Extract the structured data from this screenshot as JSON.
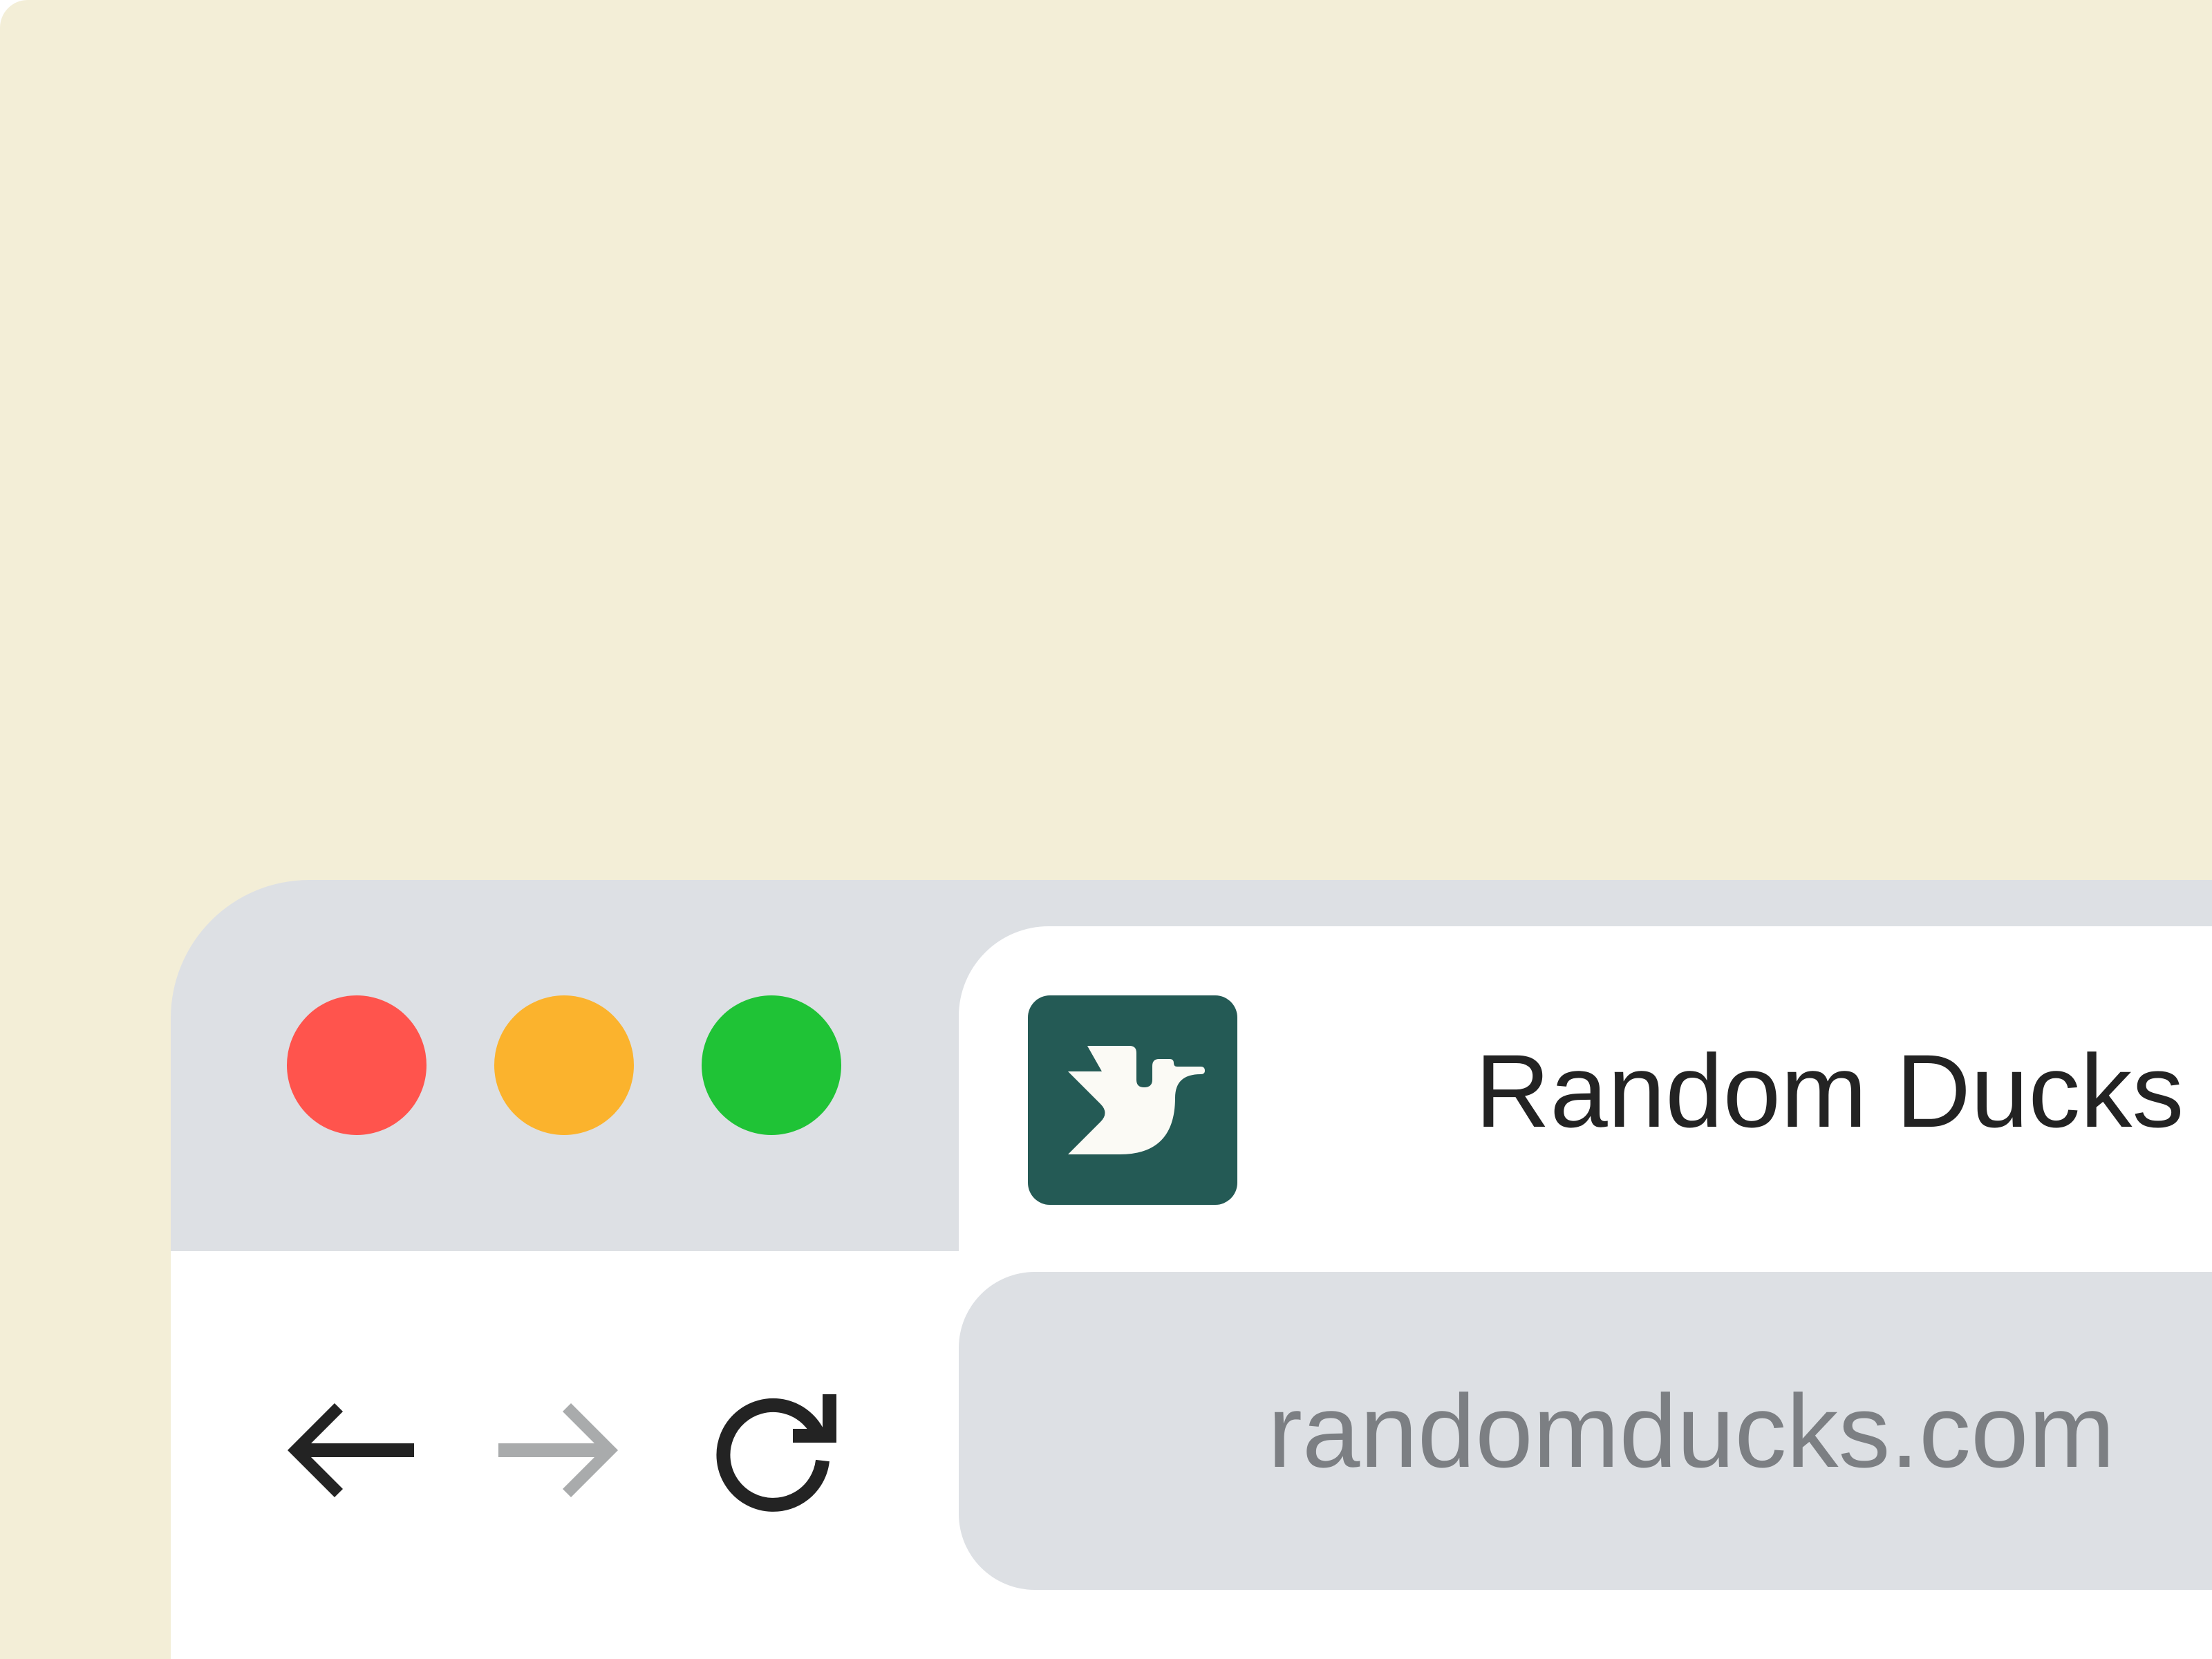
{
  "window": {
    "traffic_lights": [
      {
        "name": "close",
        "color": "#ff544d"
      },
      {
        "name": "minimize",
        "color": "#fbb32d"
      },
      {
        "name": "maximize",
        "color": "#1fc336"
      }
    ]
  },
  "tab": {
    "title": "Random Ducks",
    "favicon": "random-ducks-logo-icon",
    "favicon_color": "#245a55"
  },
  "toolbar": {
    "back": {
      "icon": "arrow-left-icon",
      "color": "#232323",
      "enabled": true
    },
    "forward": {
      "icon": "arrow-right-icon",
      "color": "#a9abac",
      "enabled": false
    },
    "reload": {
      "icon": "reload-icon",
      "color": "#232323"
    }
  },
  "addressbar": {
    "url": "randomducks.com"
  },
  "colors": {
    "backdrop": "#f3eed7",
    "chrome": "#dde0e4",
    "surface": "#ffffff",
    "text": "#232323",
    "url_text": "#7c7f83"
  }
}
